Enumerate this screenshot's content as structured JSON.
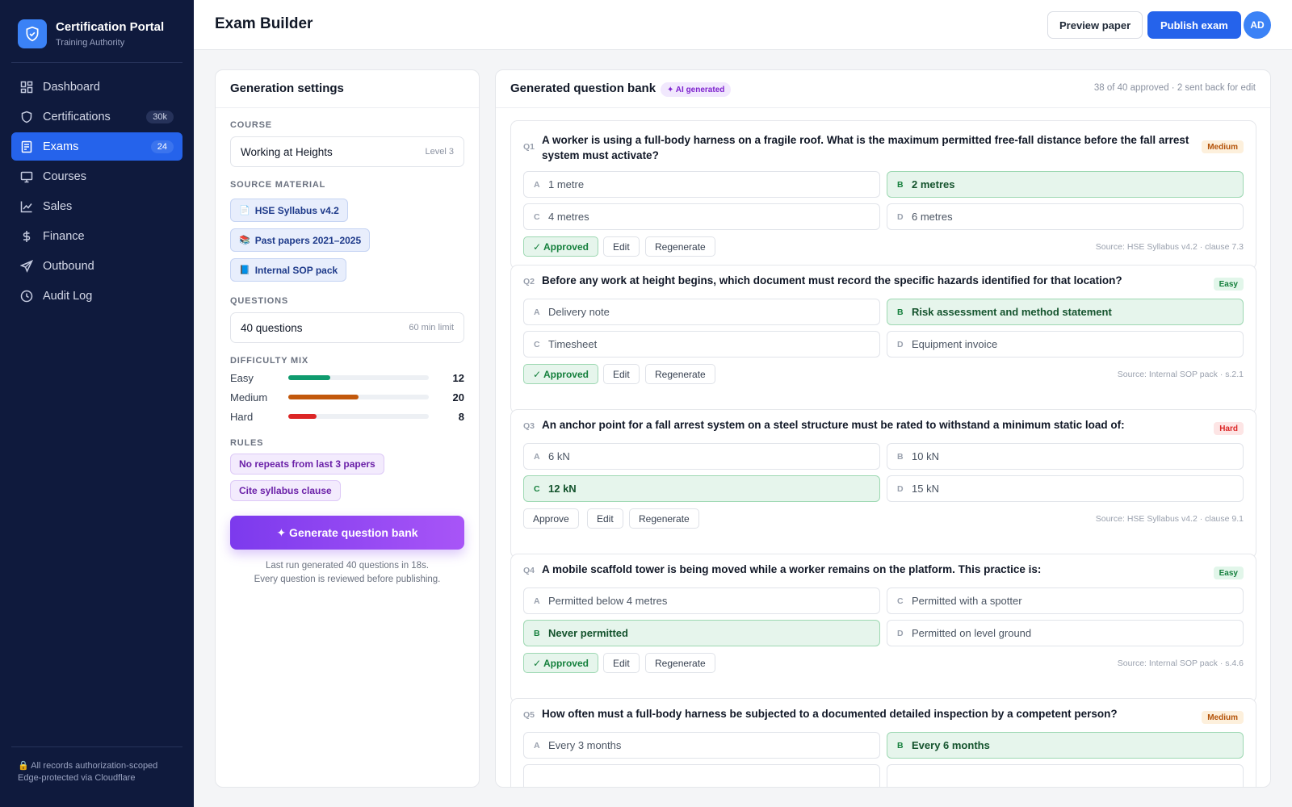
{
  "app": {
    "title": "Certification Portal",
    "subtitle": "Training Authority"
  },
  "nav": [
    {
      "label": "Dashboard",
      "icon": "dashboard-icon",
      "badge": null,
      "active": false
    },
    {
      "label": "Certifications",
      "icon": "shield-icon",
      "badge": "30k",
      "active": false
    },
    {
      "label": "Exams",
      "icon": "exam-icon",
      "badge": "24",
      "active": true
    },
    {
      "label": "Courses",
      "icon": "monitor-icon",
      "badge": null,
      "active": false
    },
    {
      "label": "Sales",
      "icon": "chart-icon",
      "badge": null,
      "active": false
    },
    {
      "label": "Finance",
      "icon": "dollar-icon",
      "badge": null,
      "active": false
    },
    {
      "label": "Outbound",
      "icon": "send-icon",
      "badge": null,
      "active": false
    },
    {
      "label": "Audit Log",
      "icon": "clock-icon",
      "badge": null,
      "active": false
    }
  ],
  "footer": {
    "line1": "All records authorization-scoped",
    "line2": "Edge-protected via Cloudflare"
  },
  "header": {
    "title": "Exam Builder",
    "preview_label": "Preview paper",
    "publish_label": "Publish exam",
    "avatar_initials": "AD"
  },
  "settings": {
    "title": "Generation settings",
    "course_label": "COURSE",
    "course_value": "Working at Heights",
    "course_level": "Level 3",
    "source_label": "SOURCE MATERIAL",
    "sources": [
      {
        "icon": "📄",
        "label": "HSE Syllabus v4.2"
      },
      {
        "icon": "📚",
        "label": "Past papers 2021–2025"
      },
      {
        "icon": "📘",
        "label": "Internal SOP pack"
      }
    ],
    "questions_label": "QUESTIONS",
    "questions_value": "40 questions",
    "questions_limit": "60 min limit",
    "difficulty_label": "DIFFICULTY MIX",
    "difficulty": [
      {
        "name": "Easy",
        "value": "12",
        "fraction": 0.3,
        "color": "#0f9b6e"
      },
      {
        "name": "Medium",
        "value": "20",
        "fraction": 0.5,
        "color": "#c2580c"
      },
      {
        "name": "Hard",
        "value": "8",
        "fraction": 0.2,
        "color": "#dc2626"
      }
    ],
    "rules_label": "RULES",
    "rules": [
      "No repeats from last 3 papers",
      "Cite syllabus clause"
    ],
    "generate_label": "✦ Generate question bank",
    "note_line1": "Last run generated 40 questions in 18s.",
    "note_line2": "Every question is reviewed before publishing."
  },
  "bank": {
    "title": "Generated question bank",
    "ai_badge": "✦ AI generated",
    "status": "38 of 40 approved · 2 sent back for edit",
    "approve_label": "Approve",
    "approved_label": "✓ Approved",
    "edit_label": "Edit",
    "regenerate_label": "Regenerate",
    "questions": [
      {
        "num": "Q1",
        "text": "A worker is using a full-body harness on a fragile roof. What is the maximum permitted free-fall distance before the fall arrest system must activate?",
        "difficulty": "Medium",
        "options": [
          {
            "letter": "A",
            "text": "1 metre",
            "correct": false
          },
          {
            "letter": "B",
            "text": "2 metres",
            "correct": true
          },
          {
            "letter": "C",
            "text": "4 metres",
            "correct": false
          },
          {
            "letter": "D",
            "text": "6 metres",
            "correct": false
          }
        ],
        "approved": true,
        "source": "Source: HSE Syllabus v4.2 · clause 7.3"
      },
      {
        "num": "Q2",
        "text": "Before any work at height begins, which document must record the specific hazards identified for that location?",
        "difficulty": "Easy",
        "options": [
          {
            "letter": "A",
            "text": "Delivery note",
            "correct": false
          },
          {
            "letter": "B",
            "text": "Risk assessment and method statement",
            "correct": true
          },
          {
            "letter": "C",
            "text": "Timesheet",
            "correct": false
          },
          {
            "letter": "D",
            "text": "Equipment invoice",
            "correct": false
          }
        ],
        "approved": true,
        "source": "Source: Internal SOP pack · s.2.1"
      },
      {
        "num": "Q3",
        "text": "An anchor point for a fall arrest system on a steel structure must be rated to withstand a minimum static load of:",
        "difficulty": "Hard",
        "options": [
          {
            "letter": "A",
            "text": "6 kN",
            "correct": false
          },
          {
            "letter": "B",
            "text": "10 kN",
            "correct": false
          },
          {
            "letter": "C",
            "text": "12 kN",
            "correct": true
          },
          {
            "letter": "D",
            "text": "15 kN",
            "correct": false
          }
        ],
        "approved": false,
        "source": "Source: HSE Syllabus v4.2 · clause 9.1"
      },
      {
        "num": "Q4",
        "text": "A mobile scaffold tower is being moved while a worker remains on the platform. This practice is:",
        "difficulty": "Easy",
        "options": [
          {
            "letter": "A",
            "text": "Permitted below 4 metres",
            "correct": false
          },
          {
            "letter": "C",
            "text": "Permitted with a spotter",
            "correct": false
          },
          {
            "letter": "B",
            "text": "Never permitted",
            "correct": true
          },
          {
            "letter": "D",
            "text": "Permitted on level ground",
            "correct": false
          }
        ],
        "approved": true,
        "source": "Source: Internal SOP pack · s.4.6"
      },
      {
        "num": "Q5",
        "text": "How often must a full-body harness be subjected to a documented detailed inspection by a competent person?",
        "difficulty": "Medium",
        "options": [
          {
            "letter": "A",
            "text": "Every 3 months",
            "correct": false
          },
          {
            "letter": "B",
            "text": "Every 6 months",
            "correct": true
          }
        ],
        "approved": null,
        "source": ""
      }
    ]
  }
}
